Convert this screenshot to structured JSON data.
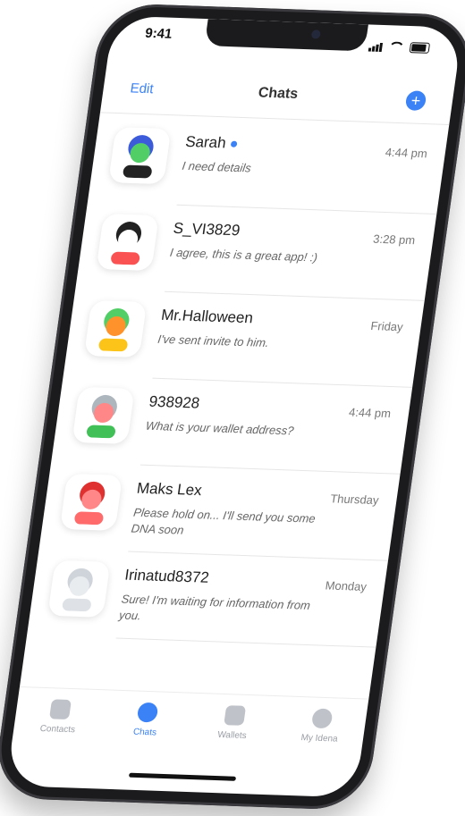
{
  "status": {
    "time": "9:41"
  },
  "nav": {
    "edit_label": "Edit",
    "title": "Chats",
    "add_symbol": "+"
  },
  "chats": [
    {
      "name": "Sarah",
      "message": "I need details",
      "time": "4:44 pm",
      "online": true,
      "hair": "#3b5bdb",
      "skin": "#51cf66",
      "shirt": "#222222"
    },
    {
      "name": "S_VI3829",
      "message": "I agree, this is a great app! :)",
      "time": "3:28 pm",
      "online": false,
      "hair": "#222222",
      "skin": "#ffffff",
      "shirt": "#fa5252"
    },
    {
      "name": "Mr.Halloween",
      "message": "I've sent invite to him.",
      "time": "Friday",
      "online": false,
      "hair": "#51cf66",
      "skin": "#ff922b",
      "shirt": "#fcc419"
    },
    {
      "name": "938928",
      "message": "What is your wallet address?",
      "time": "4:44 pm",
      "online": false,
      "hair": "#adb5bd",
      "skin": "#ff8787",
      "shirt": "#40c057"
    },
    {
      "name": "Maks Lex",
      "message": "Please hold on... I'll send you some DNA soon",
      "time": "Thursday",
      "online": false,
      "hair": "#e03131",
      "skin": "#ff8787",
      "shirt": "#ff6b6b"
    },
    {
      "name": "Irinatud8372",
      "message": "Sure! I'm waiting for information from you.",
      "time": "Monday",
      "online": false,
      "hair": "#ced4da",
      "skin": "#e9ecef",
      "shirt": "#dee2e6"
    }
  ],
  "tabs": [
    {
      "label": "Contacts",
      "icon": "contacts-icon",
      "active": false
    },
    {
      "label": "Chats",
      "icon": "chat-bubble-icon",
      "active": true
    },
    {
      "label": "Wallets",
      "icon": "wallet-icon",
      "active": false
    },
    {
      "label": "My Idena",
      "icon": "profile-icon",
      "active": false
    }
  ],
  "colors": {
    "accent": "#3b82f6",
    "bezel": "#1b1b1d"
  }
}
